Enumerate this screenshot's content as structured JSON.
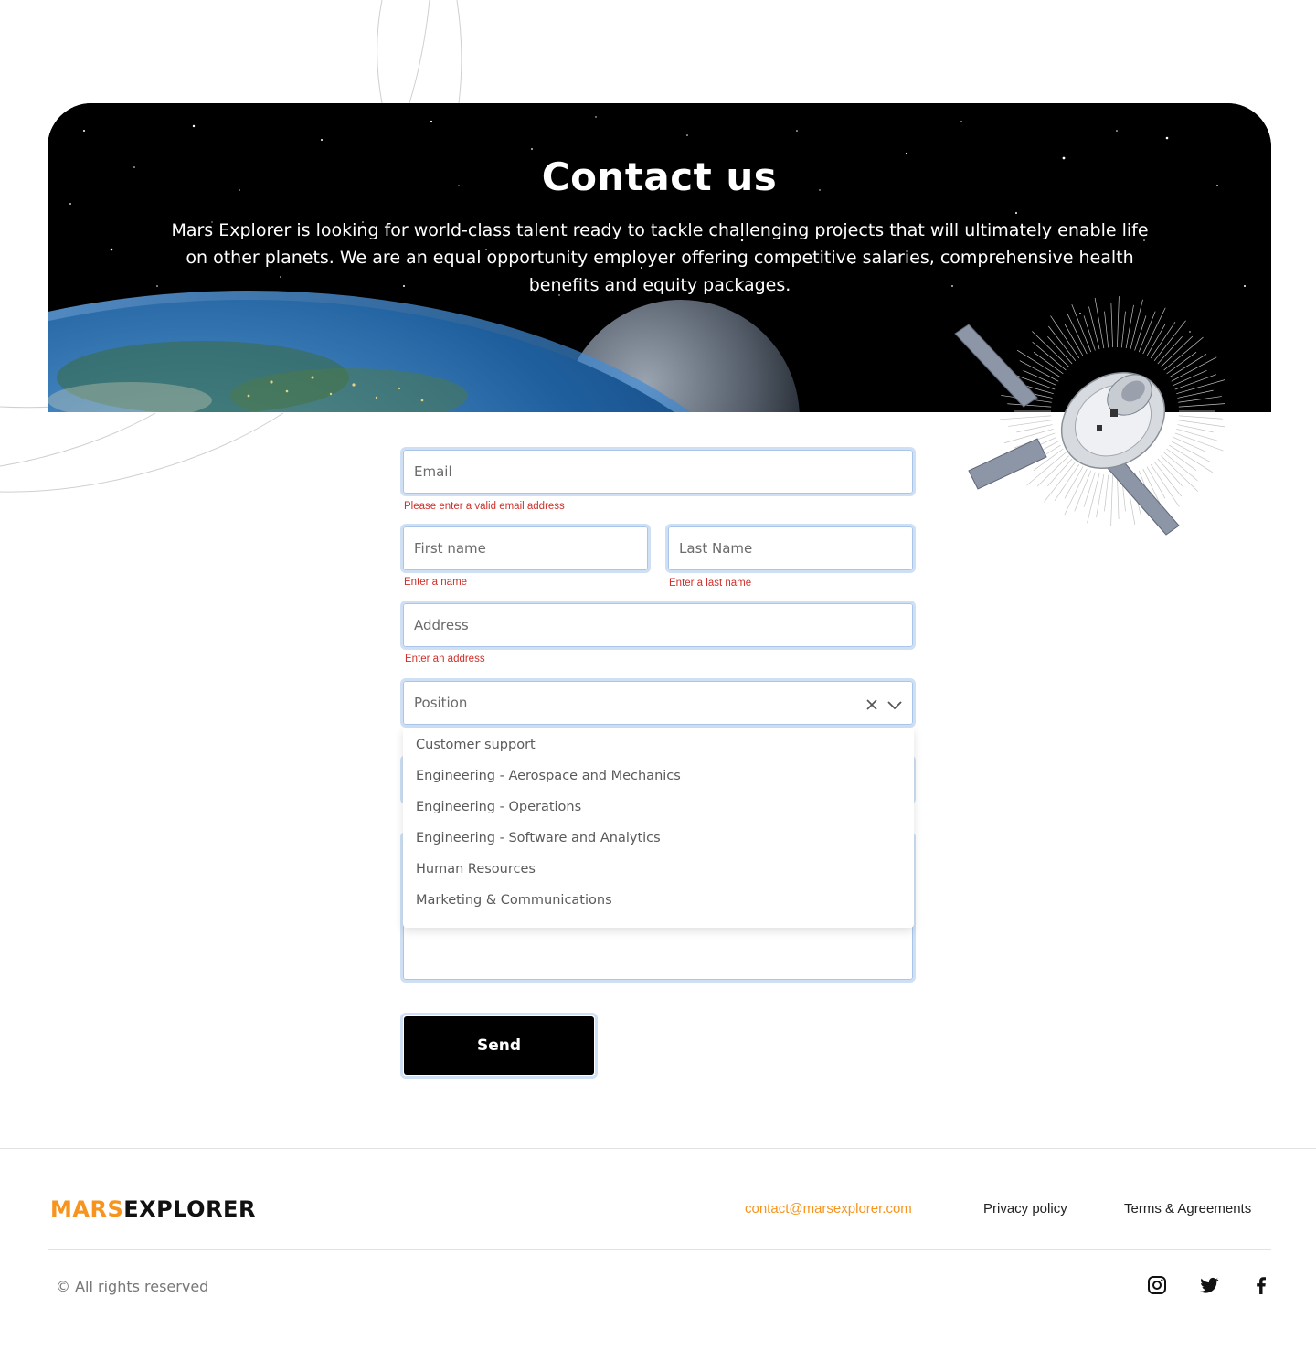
{
  "hero": {
    "title": "Contact us",
    "description": "Mars Explorer is looking for world-class talent ready to tackle challenging projects that will ultimately enable life on other planets. We are an equal opportunity employer offering competitive salaries, comprehensive health benefits and equity packages."
  },
  "form": {
    "email": {
      "placeholder": "Email",
      "error": "Please enter a valid email address"
    },
    "first_name": {
      "placeholder": "First name",
      "error": "Enter a name"
    },
    "last_name": {
      "placeholder": "Last Name",
      "error": "Enter a last name"
    },
    "address": {
      "placeholder": "Address",
      "error": "Enter an address"
    },
    "position": {
      "placeholder": "Position",
      "options": [
        "Customer support",
        "Engineering - Aerospace and Mechanics",
        "Engineering - Operations",
        "Engineering - Software and Analytics",
        "Human Resources",
        "Marketing & Communications"
      ]
    },
    "send_label": "Send"
  },
  "footer": {
    "logo_mars": "MARS",
    "logo_explorer": "EXPLORER",
    "email": "contact@marsexplorer.com",
    "privacy": "Privacy policy",
    "terms": "Terms & Agreements",
    "copyright": "© All rights reserved",
    "social_icons": [
      "instagram-icon",
      "twitter-icon",
      "facebook-icon"
    ]
  },
  "colors": {
    "accent": "#f7941d",
    "error": "#d0302a",
    "field_border": "#a9c6ea"
  }
}
